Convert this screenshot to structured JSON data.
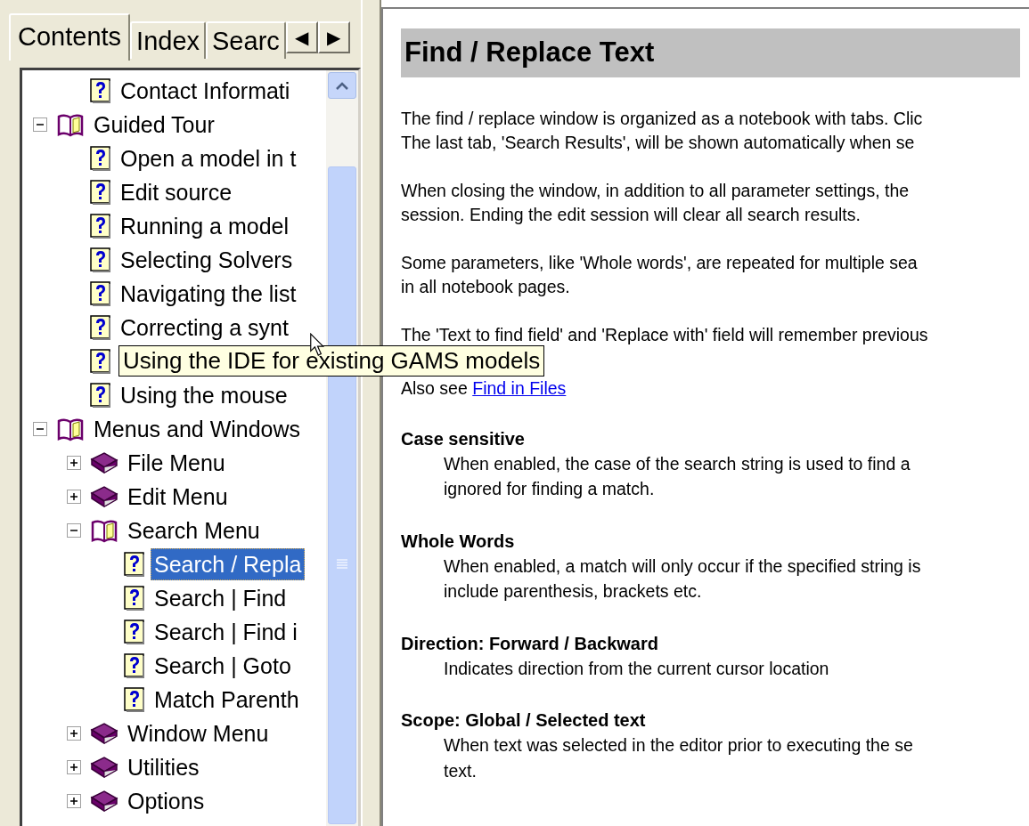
{
  "tabs": [
    {
      "label": "Contents",
      "selected": true
    },
    {
      "label": "Index",
      "selected": false
    },
    {
      "label": "Searc",
      "selected": false
    }
  ],
  "tab_scroll": [
    "◀",
    "▶"
  ],
  "tree": [
    {
      "kind": "book",
      "children": [
        {
          "kind": "topic",
          "label": "Contact Informati",
          "selected": false
        }
      ]
    },
    {
      "kind": "book",
      "label": "Guided Tour",
      "expanded": true,
      "selected": false,
      "children": [
        {
          "kind": "topic",
          "label": "Open a model in t",
          "selected": false
        },
        {
          "kind": "topic",
          "label": "Edit source",
          "selected": false
        },
        {
          "kind": "topic",
          "label": "Running a model",
          "selected": false
        },
        {
          "kind": "topic",
          "label": "Selecting Solvers",
          "selected": false
        },
        {
          "kind": "topic",
          "label": "Navigating the list",
          "selected": false
        },
        {
          "kind": "topic",
          "label": "Correcting a synt",
          "selected": false
        },
        {
          "kind": "topic"
        },
        {
          "kind": "topic",
          "label": "Using the mouse",
          "selected": false
        }
      ]
    },
    {
      "kind": "book",
      "label": "Menus and Windows",
      "expanded": true,
      "selected": false,
      "children": [
        {
          "kind": "book",
          "label": "File Menu",
          "expanded": false,
          "selected": false
        },
        {
          "kind": "book",
          "label": "Edit Menu",
          "expanded": false,
          "selected": false
        },
        {
          "kind": "book",
          "label": "Search Menu",
          "expanded": true,
          "selected": false,
          "children": [
            {
              "kind": "topic",
              "label": "Search / Repla",
              "selected": true
            },
            {
              "kind": "topic",
              "label": "Search | Find",
              "selected": false
            },
            {
              "kind": "topic",
              "label": "Search | Find i",
              "selected": false
            },
            {
              "kind": "topic",
              "label": "Search | Goto",
              "selected": false
            },
            {
              "kind": "topic",
              "label": "Match Parenth",
              "selected": false
            }
          ]
        },
        {
          "kind": "book",
          "label": "Window Menu",
          "expanded": false,
          "selected": false
        },
        {
          "kind": "book",
          "label": "Utilities",
          "expanded": false,
          "selected": false
        },
        {
          "kind": "book",
          "label": "Options",
          "expanded": false,
          "selected": false
        }
      ]
    }
  ],
  "tooltip": {
    "text": "Using the IDE for existing GAMS models"
  },
  "article": {
    "title": "Find / Replace Text",
    "paragraphs": [
      {
        "lines": [
          "The find / replace window is organized as a notebook with tabs. Clic",
          "The last tab, 'Search Results', will be shown automatically when se"
        ]
      },
      {
        "lines": [
          "When closing the window, in addition to all parameter settings, the",
          "session. Ending the edit session will clear all search results."
        ]
      },
      {
        "lines": [
          "Some parameters, like 'Whole words', are repeated for multiple sea",
          "in all notebook pages."
        ]
      },
      {
        "lines": [
          "The 'Text to find field' and 'Replace with' field will remember previous"
        ]
      }
    ],
    "see_also": {
      "text": "Also see",
      "link": "Find in Files"
    },
    "definitions": [
      {
        "term": "Case sensitive",
        "lines": [
          "When enabled, the case of the search string is used to find a",
          "ignored for finding a match."
        ]
      },
      {
        "term": "Whole Words",
        "lines": [
          "When enabled, a match will only occur if the specified string is",
          "include parenthesis, brackets etc."
        ]
      },
      {
        "term": "Direction: Forward / Backward",
        "lines": [
          "Indicates direction from the current cursor location"
        ]
      },
      {
        "term": "Scope: Global / Selected text",
        "lines": [
          "When text was selected in the editor prior to executing the se",
          "text."
        ]
      }
    ]
  }
}
